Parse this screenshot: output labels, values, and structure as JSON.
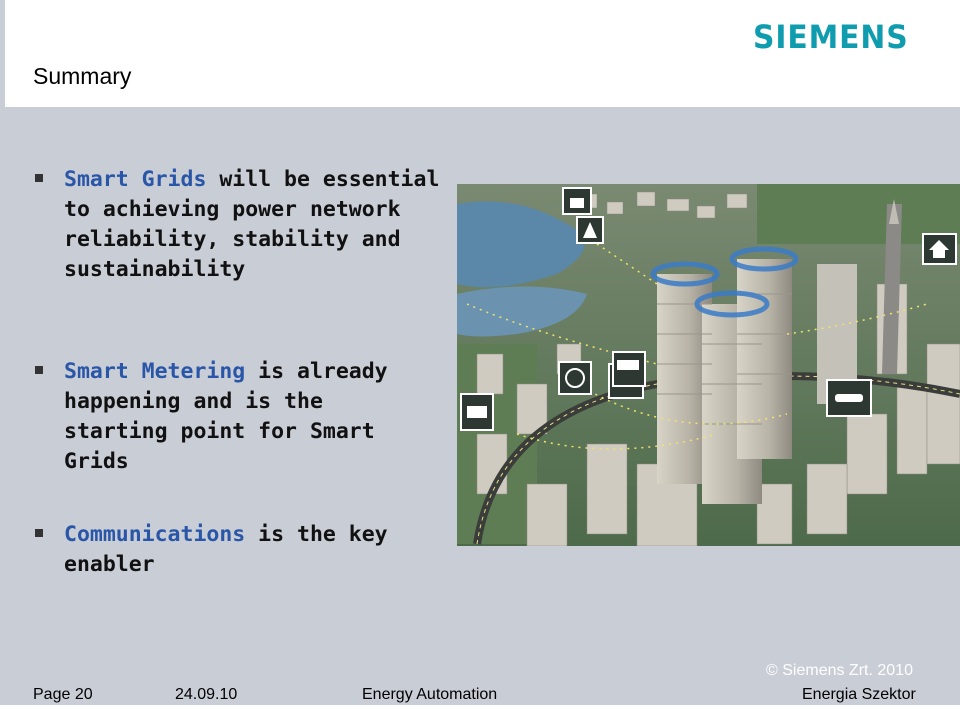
{
  "header": {
    "title": "Summary",
    "logo_text": "SIEMENS",
    "logo_color": "#0f9caf"
  },
  "bullets": [
    {
      "highlight": "Smart Grids",
      "rest": " will be essential to achieving power network reliability, stability and sustainability"
    },
    {
      "highlight": "Smart Metering",
      "rest": " is already happening and is the starting point for Smart Grids"
    },
    {
      "highlight": "Communications",
      "rest": " is the key enabler"
    }
  ],
  "colors": {
    "background": "#c9cdd6",
    "highlight": "#2a56a8"
  },
  "footer": {
    "page": "Page 20",
    "date": "24.09.10",
    "topic": "Energy Automation",
    "copyright": "© Siemens Zrt. 2010",
    "sector": "Energia Szektor"
  }
}
